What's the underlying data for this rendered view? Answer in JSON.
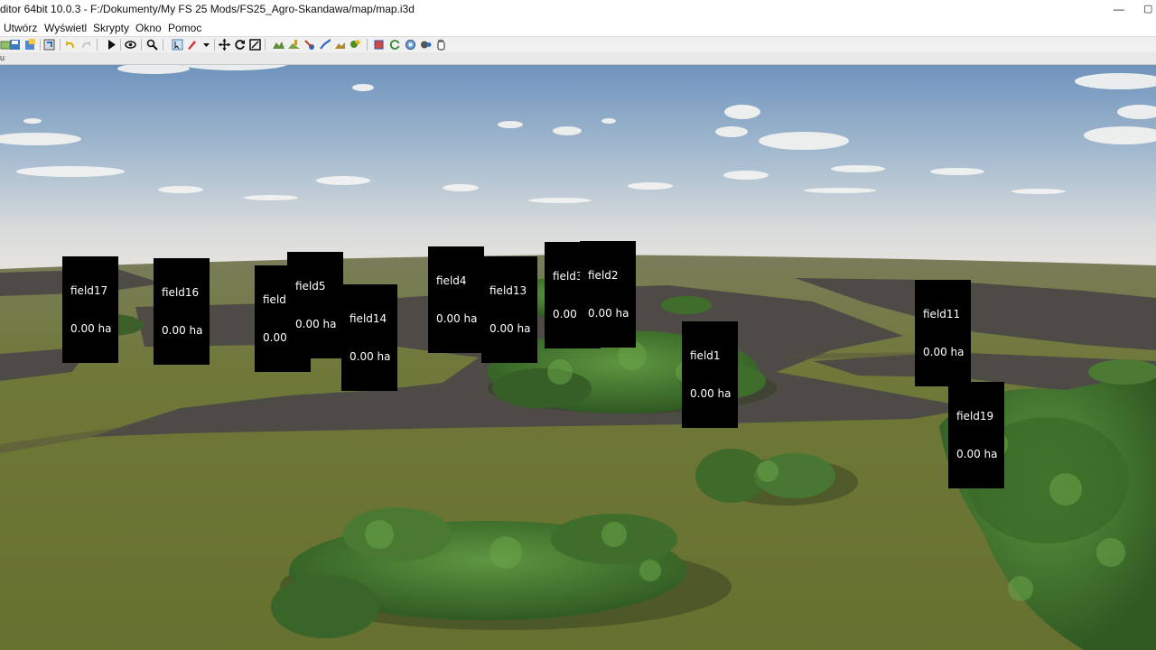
{
  "window": {
    "title": "ditor 64bit 10.0.3 - F:/Dokumenty/My FS 25 Mods/FS25_Agro-Skandawa/map/map.i3d",
    "minimize_glyph": "—",
    "maximize_glyph": "▢"
  },
  "menu": {
    "items": [
      "Utwórz",
      "Wyświetl",
      "Skrypty",
      "Okno",
      "Pomoc"
    ]
  },
  "toolbar": {
    "icons": [
      "new-file-icon",
      "save-icon",
      "save-as-icon",
      "import-icon",
      "undo-icon",
      "redo-icon",
      "play-icon",
      "eye-icon",
      "search-icon",
      "select-icon",
      "paint-icon",
      "dropdown-arrow-icon",
      "move-icon",
      "rotate-icon",
      "scale-icon",
      "terrain-sculpt-icon",
      "terrain-paint-icon",
      "foliage-paint-icon",
      "brush-icon",
      "fill-icon",
      "add-object-icon",
      "cube-icon",
      "refresh-icon",
      "settings-icon",
      "gear-icon",
      "hand-icon"
    ]
  },
  "tabstrip": {
    "label": "u"
  },
  "viewport": {
    "fields": [
      {
        "name": "field17",
        "area": "0.00 ha"
      },
      {
        "name": "field16",
        "area": "0.00 ha"
      },
      {
        "name": "field15",
        "area": "0.00 ha"
      },
      {
        "name": "field5",
        "area": "0.00 ha"
      },
      {
        "name": "field14",
        "area": "0.00 ha"
      },
      {
        "name": "field4",
        "area": "0.00 ha"
      },
      {
        "name": "field13",
        "area": "0.00 ha"
      },
      {
        "name": "field3",
        "area": "0.00 ha"
      },
      {
        "name": "field2",
        "area": "0.00 ha"
      },
      {
        "name": "field1",
        "area": "0.00 ha"
      },
      {
        "name": "field11",
        "area": "0.00 ha"
      },
      {
        "name": "field19",
        "area": "0.00 ha"
      }
    ]
  },
  "colors": {
    "sky_top": "#6f93bd",
    "sky_horizon": "#e7e4df",
    "grass": "#6d7536",
    "plowed": "#4d4a45",
    "tree": "#3f6d2b",
    "label_bg": "#000000"
  }
}
